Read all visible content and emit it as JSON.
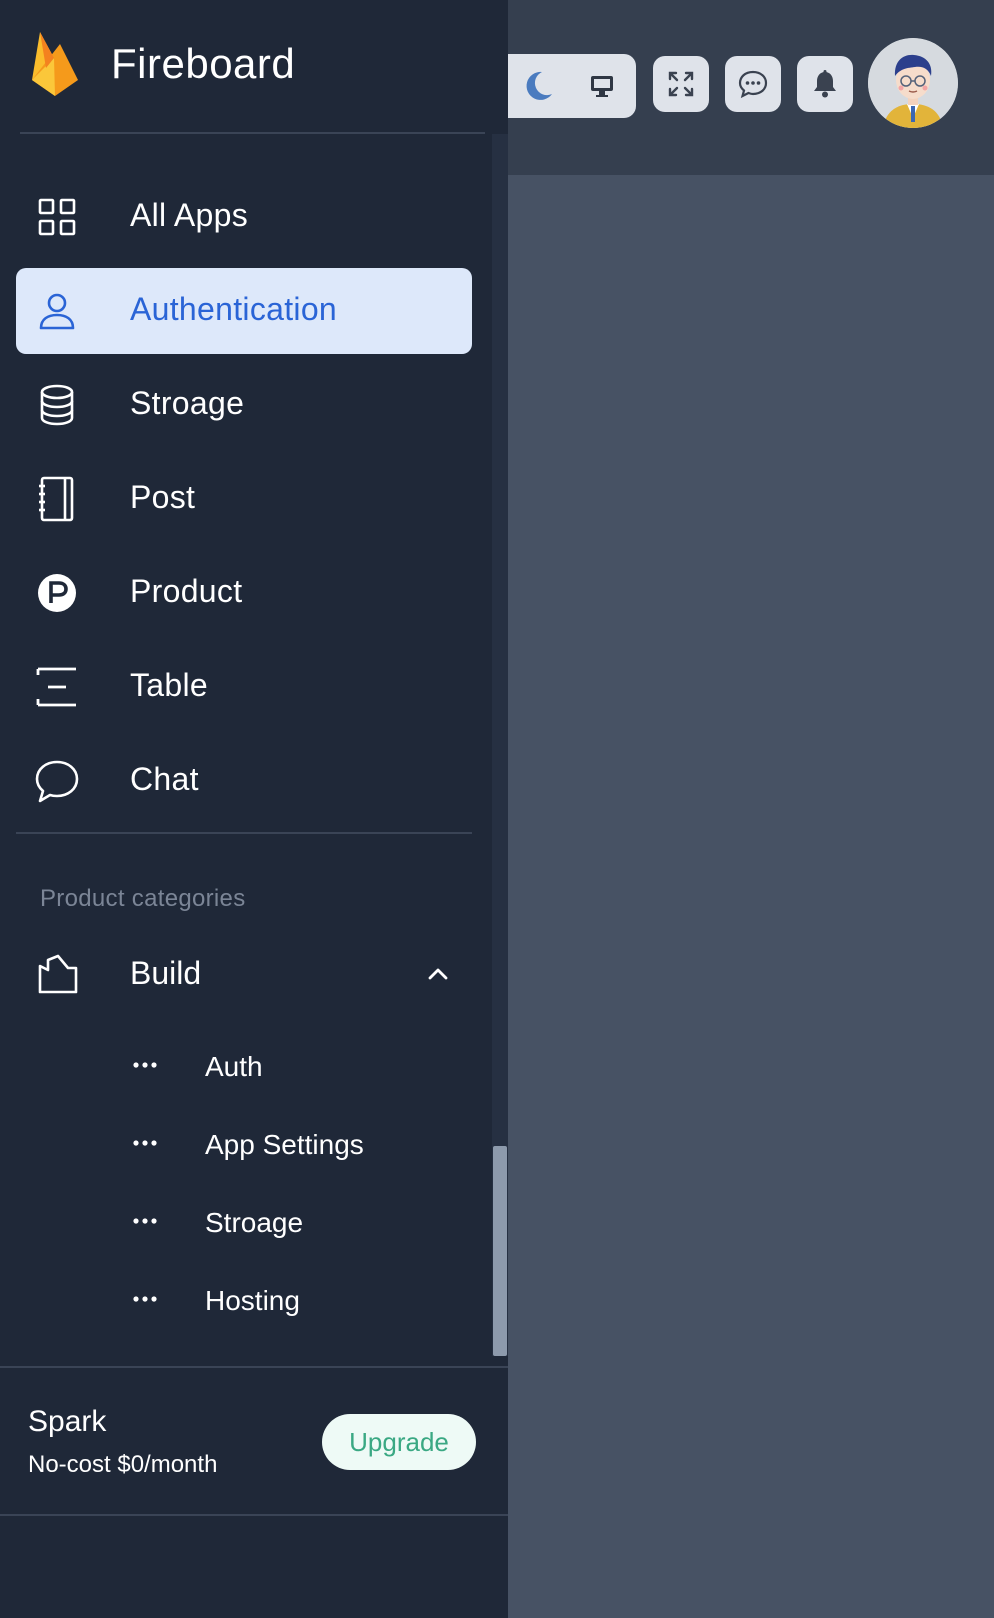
{
  "brand": {
    "name": "Fireboard"
  },
  "nav": {
    "items": [
      {
        "label": "All Apps",
        "icon": "grid-icon"
      },
      {
        "label": "Authentication",
        "icon": "user-icon",
        "active": true
      },
      {
        "label": "Stroage",
        "icon": "database-icon"
      },
      {
        "label": "Post",
        "icon": "notebook-icon"
      },
      {
        "label": "Product",
        "icon": "product-p-icon"
      },
      {
        "label": "Table",
        "icon": "table-icon"
      },
      {
        "label": "Chat",
        "icon": "chat-bubble-icon"
      }
    ]
  },
  "categories": {
    "title": "Product categories",
    "group": {
      "label": "Build",
      "expanded": true,
      "children": [
        {
          "label": "Auth"
        },
        {
          "label": "App Settings"
        },
        {
          "label": "Stroage"
        },
        {
          "label": "Hosting"
        }
      ]
    }
  },
  "plan": {
    "name": "Spark",
    "price": "No-cost $0/month",
    "upgrade_label": "Upgrade"
  },
  "header": {
    "icons": [
      "moon-icon",
      "monitor-icon",
      "fullscreen-icon",
      "chat-icon",
      "bell-icon"
    ]
  },
  "colors": {
    "sidebar_bg": "#1f2838",
    "active_bg": "#dde8fa",
    "active_text": "#2a64d6",
    "upgrade_text": "#3aa883"
  }
}
